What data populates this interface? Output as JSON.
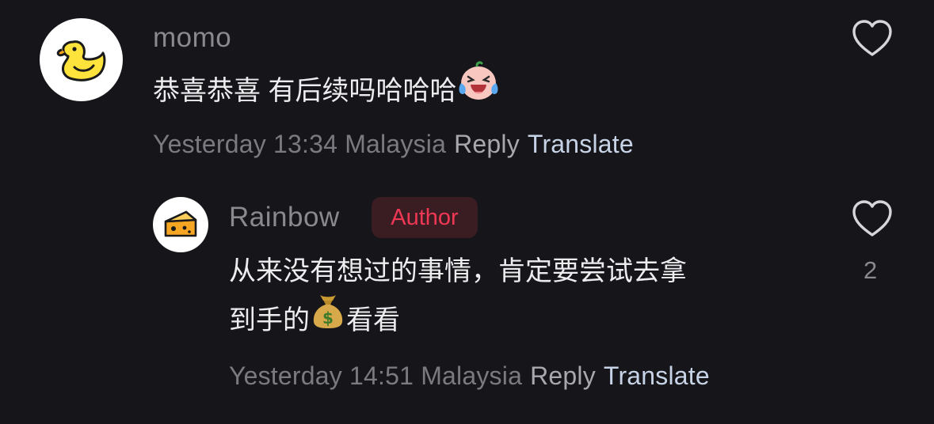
{
  "comments": [
    {
      "avatar_icon": "duck-icon",
      "username": "momo",
      "text": "恭喜恭喜  有后续吗哈哈哈",
      "text_emoji": "laughing-crying-face-icon",
      "timestamp": "Yesterday 13:34 Malaysia",
      "reply_label": "Reply",
      "translate_label": "Translate",
      "like_count": ""
    },
    {
      "avatar_icon": "cheese-icon",
      "username": "Rainbow",
      "badge": "Author",
      "text_line1": "从来没有想过的事情，肯定要尝试去拿",
      "text_line2_a": "到手的",
      "text_emoji": "money-bag-icon",
      "text_line2_b": "看看",
      "timestamp": "Yesterday 14:51 Malaysia",
      "reply_label": "Reply",
      "translate_label": "Translate",
      "like_count": "2"
    }
  ],
  "colors": {
    "background": "#161519",
    "author_badge_text": "#f03855",
    "translate_link": "#c7d3e6"
  }
}
